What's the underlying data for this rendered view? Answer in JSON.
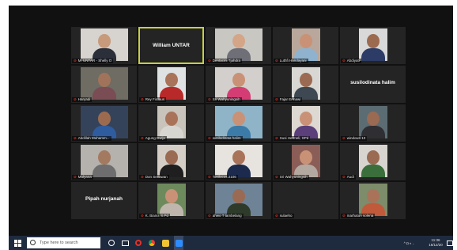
{
  "meeting": {
    "participants": [
      {
        "name": "M. UNTAR - Shelly O",
        "muted": true,
        "kind": "video",
        "bg": "#d7d3cf",
        "skin": "#c79a7b",
        "cloth": "#2b2f3a",
        "logo": "UNTAR"
      },
      {
        "name": "William UNTAR",
        "muted": false,
        "kind": "name",
        "active": true
      },
      {
        "name": "Dentacini Tjahdra",
        "muted": true,
        "kind": "video",
        "bg": "#c9c7c2",
        "skin": "#d4a587",
        "cloth": "#6f6f78"
      },
      {
        "name": "Luthfi Handayani",
        "muted": true,
        "kind": "video",
        "bg": "#b8a79a",
        "skin": "#c99276",
        "cloth": "#8fb3cf"
      },
      {
        "name": "Abdiyati",
        "muted": true,
        "kind": "video",
        "bg": "#d9d9d9",
        "skin": "#9c6b4f",
        "cloth": "#2c3c66"
      },
      {
        "name": "Haryadi",
        "muted": true,
        "kind": "video",
        "bg": "#6e6c63",
        "skin": "#a0735a",
        "cloth": "#7a4c54"
      },
      {
        "name": "Rey Firdaus",
        "muted": true,
        "kind": "video",
        "bg": "#dfe2e2",
        "skin": "#a9735a",
        "cloth": "#b82a2a"
      },
      {
        "name": "Sri Wahyuningsih",
        "muted": true,
        "kind": "video",
        "bg": "#d3cfcc",
        "skin": "#c99276",
        "cloth": "#d43d73"
      },
      {
        "name": "Fajar Ermawi",
        "muted": true,
        "kind": "video",
        "bg": "#d9d7d3",
        "skin": "#9a6a52",
        "cloth": "#3d4852"
      },
      {
        "name": "susilodinata halim",
        "muted": false,
        "kind": "name"
      },
      {
        "name": "Abdillah Muhamm...",
        "muted": true,
        "kind": "video",
        "bg": "#35435a",
        "skin": "#9c6b4f",
        "cloth": "#2f5c9e"
      },
      {
        "name": "Agung Dwijo",
        "muted": true,
        "kind": "video",
        "bg": "#c9c4bb",
        "skin": "#a9735a",
        "cloth": "#d8d6d0"
      },
      {
        "name": "susilodinata halim",
        "muted": true,
        "kind": "video",
        "bg": "#8fb4c7",
        "skin": "#c99276",
        "cloth": "#3c7ba8"
      },
      {
        "name": "Susi Hermeli, SPd",
        "muted": true,
        "kind": "video",
        "bg": "#ddd8d1",
        "skin": "#c99276",
        "cloth": "#5a3f7a"
      },
      {
        "name": "windows 10",
        "muted": true,
        "kind": "video",
        "bg": "#5c6c73",
        "skin": "#9a6a52",
        "cloth": "#2f2f33"
      },
      {
        "name": "Mulyana",
        "muted": true,
        "kind": "video",
        "bg": "#b5b1ad",
        "skin": "#a37a60",
        "cloth": "#6e6e6e"
      },
      {
        "name": "Don Setiawan",
        "muted": true,
        "kind": "video",
        "bg": "#d5cec6",
        "skin": "#9a6a52",
        "cloth": "#1f1f1f"
      },
      {
        "name": "Tonilocos 2106",
        "muted": true,
        "kind": "video",
        "bg": "#e7e4e0",
        "skin": "#a9735a",
        "cloth": "#1c2a4d"
      },
      {
        "name": "Sri Wahyuningsih",
        "muted": true,
        "kind": "video",
        "bg": "#8a5d56",
        "skin": "#c99276",
        "cloth": "#b4a9a0"
      },
      {
        "name": "Audi",
        "muted": true,
        "kind": "video",
        "bg": "#d8d5d0",
        "skin": "#9a6a52",
        "cloth": "#3a6e3a"
      },
      {
        "name": "Pipah nurjanah",
        "muted": false,
        "kind": "name"
      },
      {
        "name": "K. Bianu. S.Pd",
        "muted": true,
        "kind": "video",
        "bg": "#6d8a5d",
        "skin": "#c99276",
        "cloth": "#bfb7ad"
      },
      {
        "name": "ahwo T tambelang",
        "muted": true,
        "kind": "video",
        "bg": "#6f8396",
        "skin": "#9a6a52",
        "cloth": "#2f3b2a"
      },
      {
        "name": "sulaeho",
        "muted": true,
        "kind": "empty"
      },
      {
        "name": "marhatun solena",
        "muted": true,
        "kind": "video",
        "bg": "#7d8c6a",
        "skin": "#a9735a",
        "cloth": "#c05a3a"
      }
    ]
  },
  "taskbar": {
    "search_placeholder": "Type here to search",
    "tray_icons": "^ ◘ ◐ 𝅘",
    "time": "11:36",
    "date": "16/12/20"
  }
}
